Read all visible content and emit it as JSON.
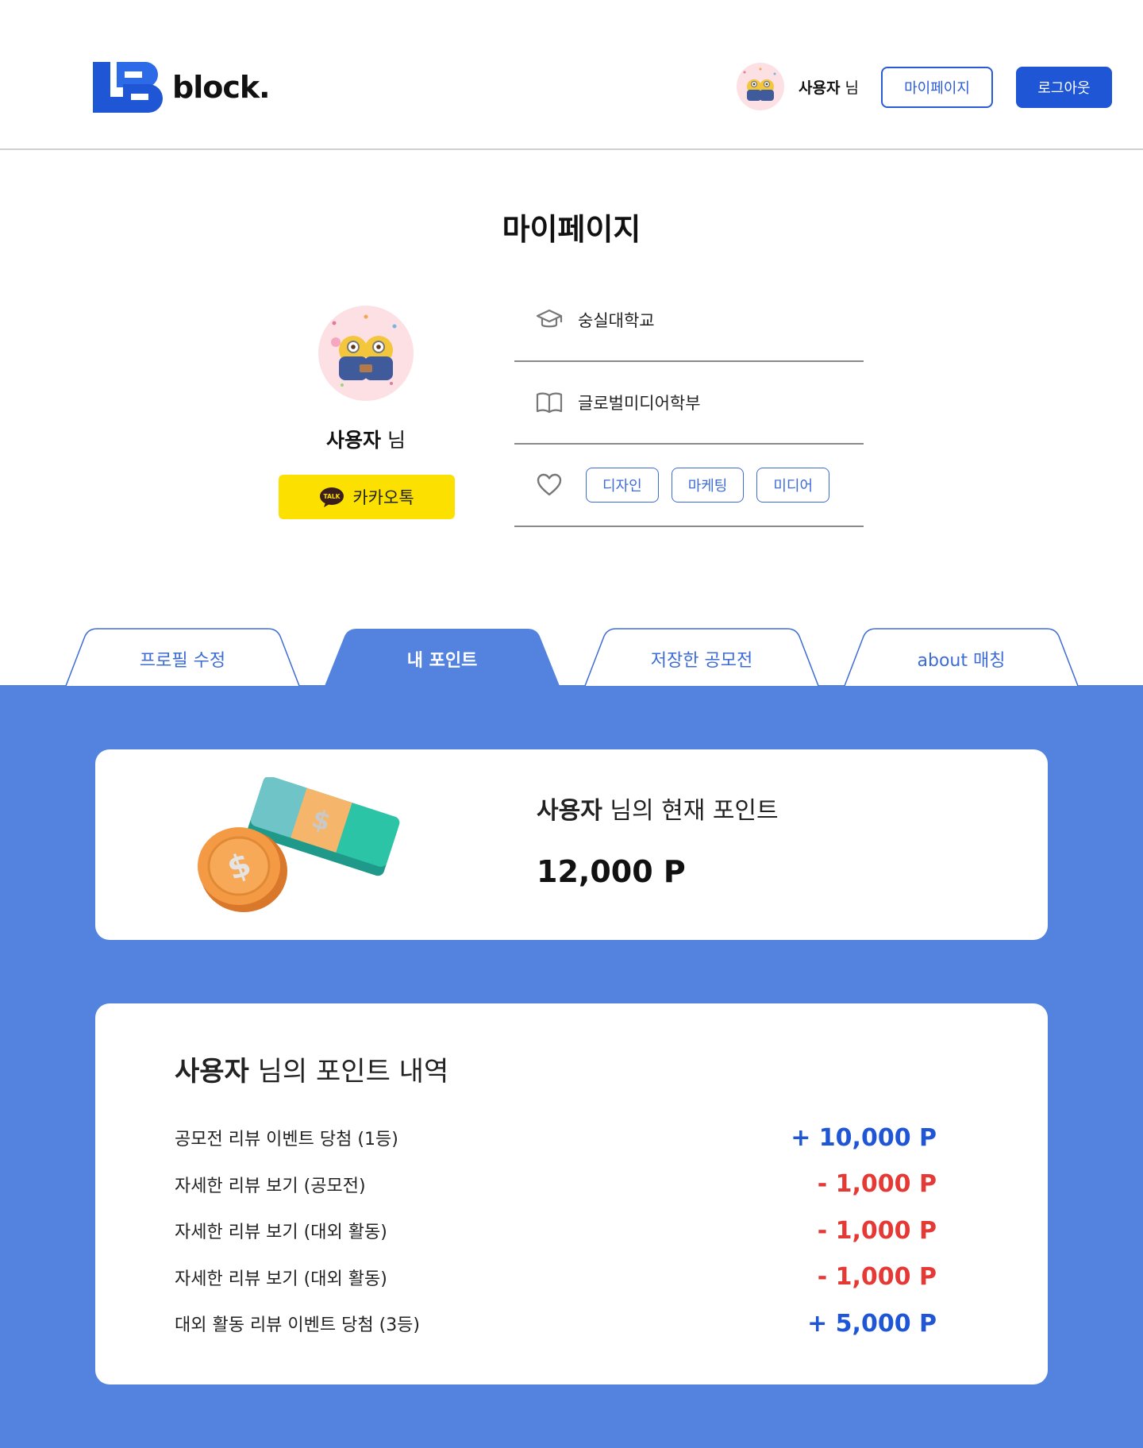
{
  "header": {
    "logo_text": "block.",
    "username": "사용자",
    "username_suffix": "님",
    "mypage_label": "마이페이지",
    "logout_label": "로그아웃"
  },
  "page": {
    "title": "마이페이지"
  },
  "profile": {
    "name": "사용자",
    "name_suffix": "님",
    "kakao_label": "카카오톡",
    "kakao_badge": "TALK",
    "school": "숭실대학교",
    "major": "글로벌미디어학부",
    "interests": [
      "디자인",
      "마케팅",
      "미디어"
    ]
  },
  "tabs": [
    {
      "label": "프로필 수정",
      "active": false
    },
    {
      "label": "내 포인트",
      "active": true
    },
    {
      "label": "저장한 공모전",
      "active": false
    },
    {
      "label": "about 매칭",
      "active": false
    }
  ],
  "points": {
    "user": "사용자",
    "label_suffix": "님의 현재 포인트",
    "value": "12,000 P"
  },
  "history": {
    "user": "사용자",
    "title_suffix": "님의 포인트 내역",
    "items": [
      {
        "desc": "공모전 리뷰 이벤트 당첨 (1등)",
        "amount": "+ 10,000 P",
        "type": "plus"
      },
      {
        "desc": "자세한 리뷰 보기 (공모전)",
        "amount": "- 1,000 P",
        "type": "minus"
      },
      {
        "desc": "자세한 리뷰 보기 (대외 활동)",
        "amount": "- 1,000 P",
        "type": "minus"
      },
      {
        "desc": "자세한 리뷰 보기 (대외 활동)",
        "amount": "- 1,000 P",
        "type": "minus"
      },
      {
        "desc": "대외 활동 리뷰 이벤트 당첨 (3등)",
        "amount": "+ 5,000 P",
        "type": "plus"
      }
    ]
  },
  "colors": {
    "primary": "#1f56d6",
    "accent_blue": "#3d6cd6",
    "section_bg": "#5383de",
    "kakao": "#fce100",
    "minus": "#e53935"
  },
  "icons": {
    "school": "graduation-cap-icon",
    "major": "book-icon",
    "interest": "heart-icon"
  }
}
